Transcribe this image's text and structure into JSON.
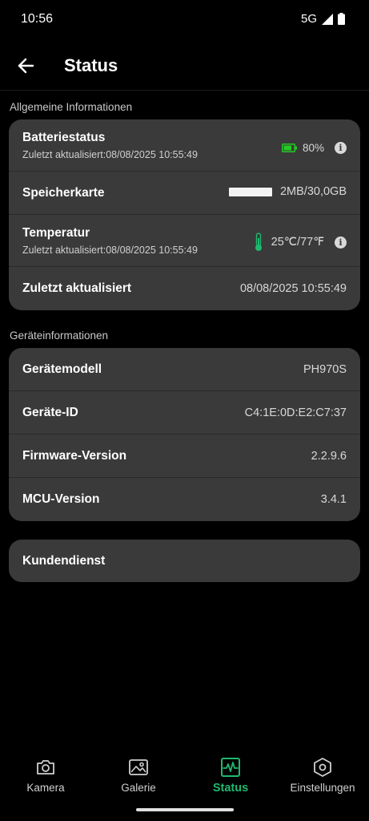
{
  "status_bar": {
    "time": "10:56",
    "network": "5G",
    "signal_icon": "signal-icon",
    "battery_icon": "battery-icon"
  },
  "header": {
    "back_icon": "arrow-left-icon",
    "title": "Status"
  },
  "general": {
    "label": "Allgemeine Informationen",
    "battery": {
      "title": "Batteriestatus",
      "subtitle": "Zuletzt aktualisiert:08/08/2025 10:55:49",
      "value": "80%",
      "level": 0.8,
      "color": "#22cc22"
    },
    "storage": {
      "title": "Speicherkarte",
      "value": "2MB/30,0GB"
    },
    "temperature": {
      "title": "Temperatur",
      "subtitle": "Zuletzt aktualisiert:08/08/2025 10:55:49",
      "value": "25℃/77℉",
      "icon": "thermometer-icon",
      "color": "#1fb86f"
    },
    "last_updated": {
      "title": "Zuletzt aktualisiert",
      "value": "08/08/2025 10:55:49"
    }
  },
  "device": {
    "label": "Geräteinformationen",
    "model": {
      "title": "Gerätemodell",
      "value": "PH970S"
    },
    "id": {
      "title": "Geräte-ID",
      "value": "C4:1E:0D:E2:C7:37"
    },
    "firmware": {
      "title": "Firmware-Version",
      "value": "2.2.9.6"
    },
    "mcu": {
      "title": "MCU-Version",
      "value": "3.4.1"
    }
  },
  "support": {
    "title": "Kundendienst"
  },
  "nav": {
    "accent": "#1fb86f",
    "items": [
      {
        "label": "Kamera",
        "icon": "camera-icon"
      },
      {
        "label": "Galerie",
        "icon": "gallery-icon"
      },
      {
        "label": "Status",
        "icon": "status-pulse-icon",
        "active": true
      },
      {
        "label": "Einstellungen",
        "icon": "settings-hexagon-icon"
      }
    ]
  }
}
